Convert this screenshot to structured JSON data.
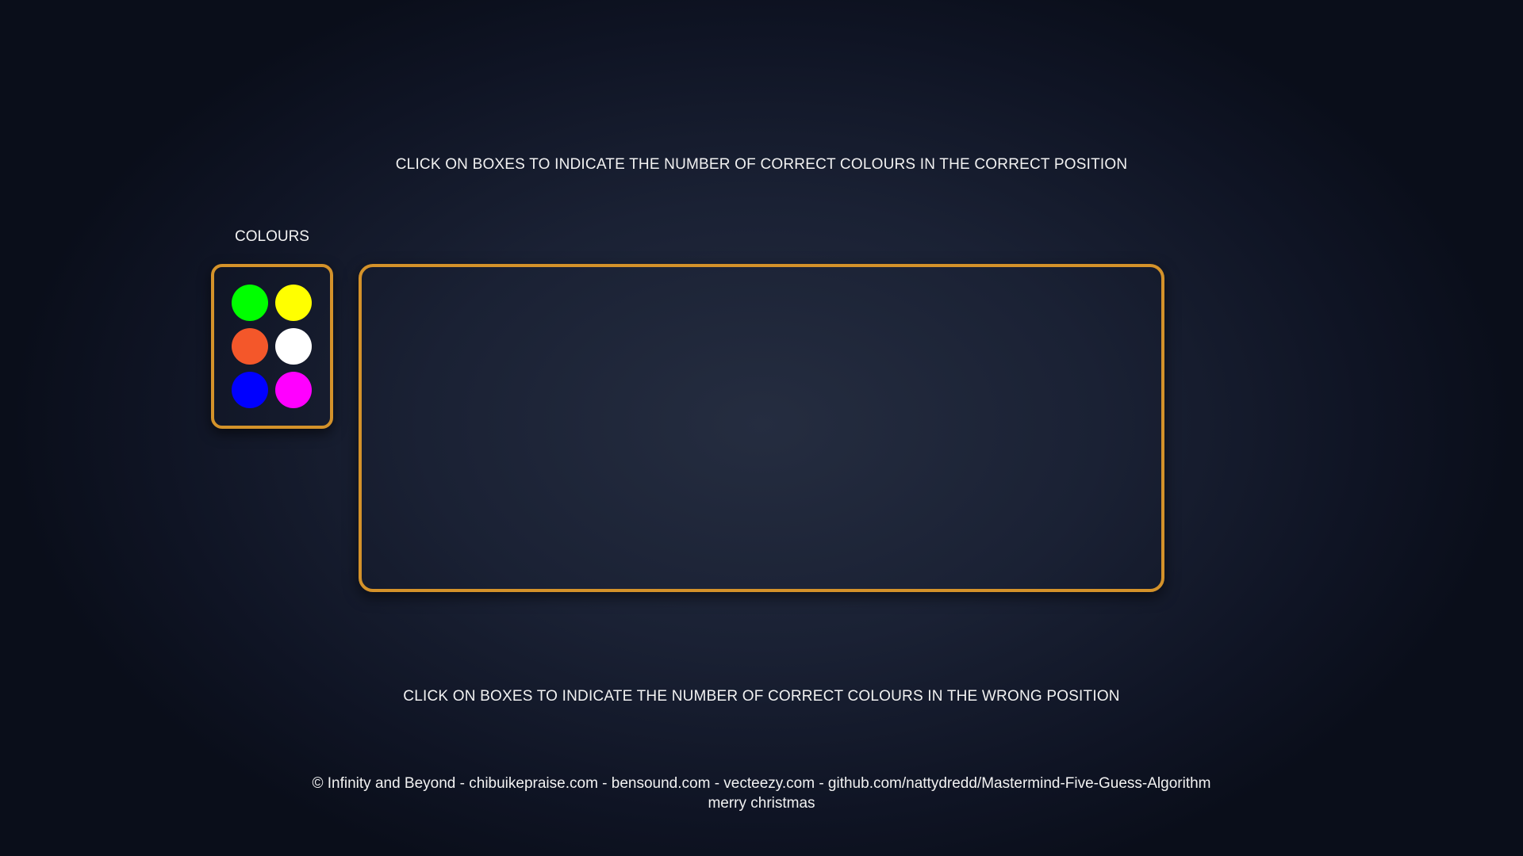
{
  "instructions": {
    "top": "CLICK ON BOXES TO INDICATE THE NUMBER OF CORRECT COLOURS IN THE CORRECT POSITION",
    "bottom": "CLICK ON BOXES TO INDICATE THE NUMBER OF CORRECT COLOURS IN THE WRONG POSITION"
  },
  "palette": {
    "title": "COLOURS",
    "border_color": "#d4922a",
    "colors": [
      {
        "name": "green",
        "hex": "#00ff00"
      },
      {
        "name": "yellow",
        "hex": "#ffff00"
      },
      {
        "name": "orange",
        "hex": "#f4572a"
      },
      {
        "name": "white",
        "hex": "#ffffff"
      },
      {
        "name": "blue",
        "hex": "#0000ff"
      },
      {
        "name": "magenta",
        "hex": "#ff00ff"
      }
    ]
  },
  "board": {
    "border_color": "#d4922a"
  },
  "footer": {
    "credits": "© Infinity and Beyond - chibuikepraise.com - bensound.com - vecteezy.com - github.com/nattydredd/Mastermind-Five-Guess-Algorithm",
    "message": "merry christmas"
  }
}
